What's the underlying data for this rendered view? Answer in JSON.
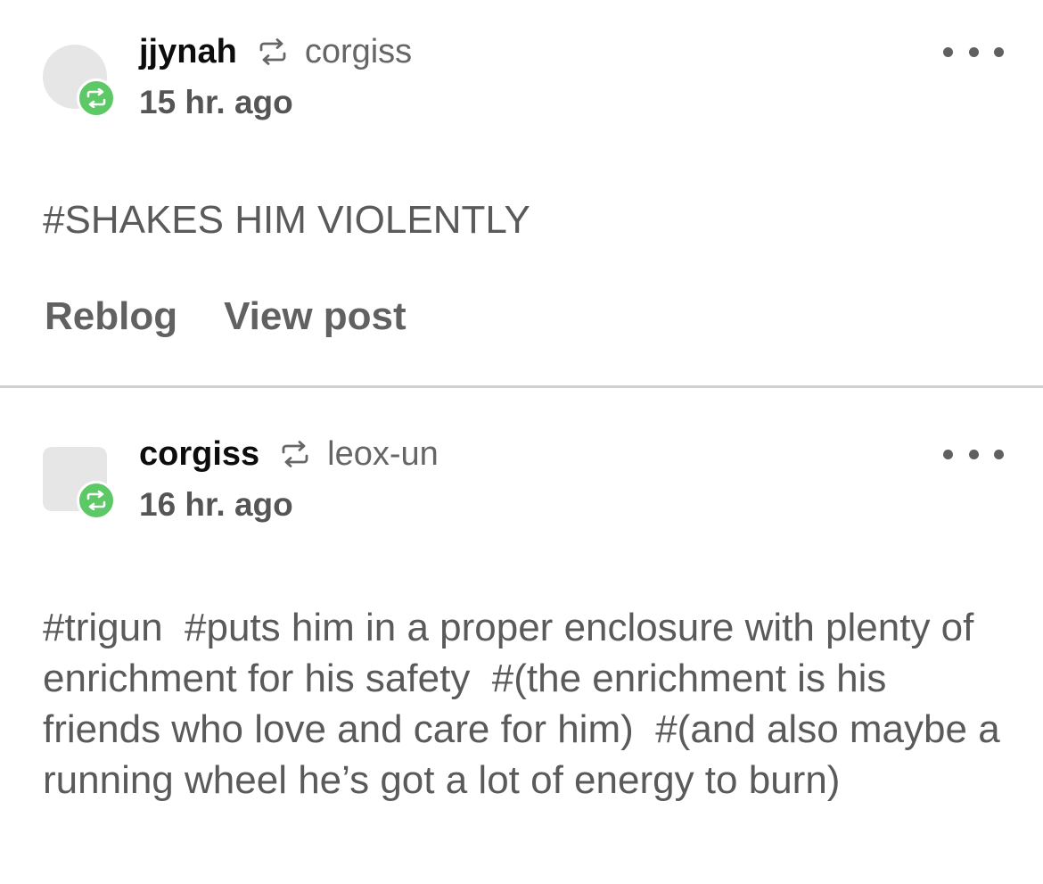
{
  "colors": {
    "reblog_green": "#5cc866",
    "avatar_placeholder": "#e6e6e6",
    "divider": "#cfcfcf"
  },
  "icons": {
    "reblog": "reblog-icon",
    "more": "more-options-icon"
  },
  "posts": [
    {
      "username": "jjynah",
      "reblogged_from": "corgiss",
      "timestamp": "15 hr. ago",
      "tags_text": "#SHAKES HIM VIOLENTLY",
      "actions": {
        "reblog": "Reblog",
        "view_post": "View post"
      }
    },
    {
      "username": "corgiss",
      "reblogged_from": "leox-un",
      "timestamp": "16 hr. ago",
      "tags": [
        "#trigun",
        "#puts him in a proper enclosure with plenty of enrichment for his safety",
        "#(the enrichment is his friends who love and care for him)",
        "#(and also maybe a running wheel he’s got a lot of energy to burn)"
      ]
    }
  ]
}
